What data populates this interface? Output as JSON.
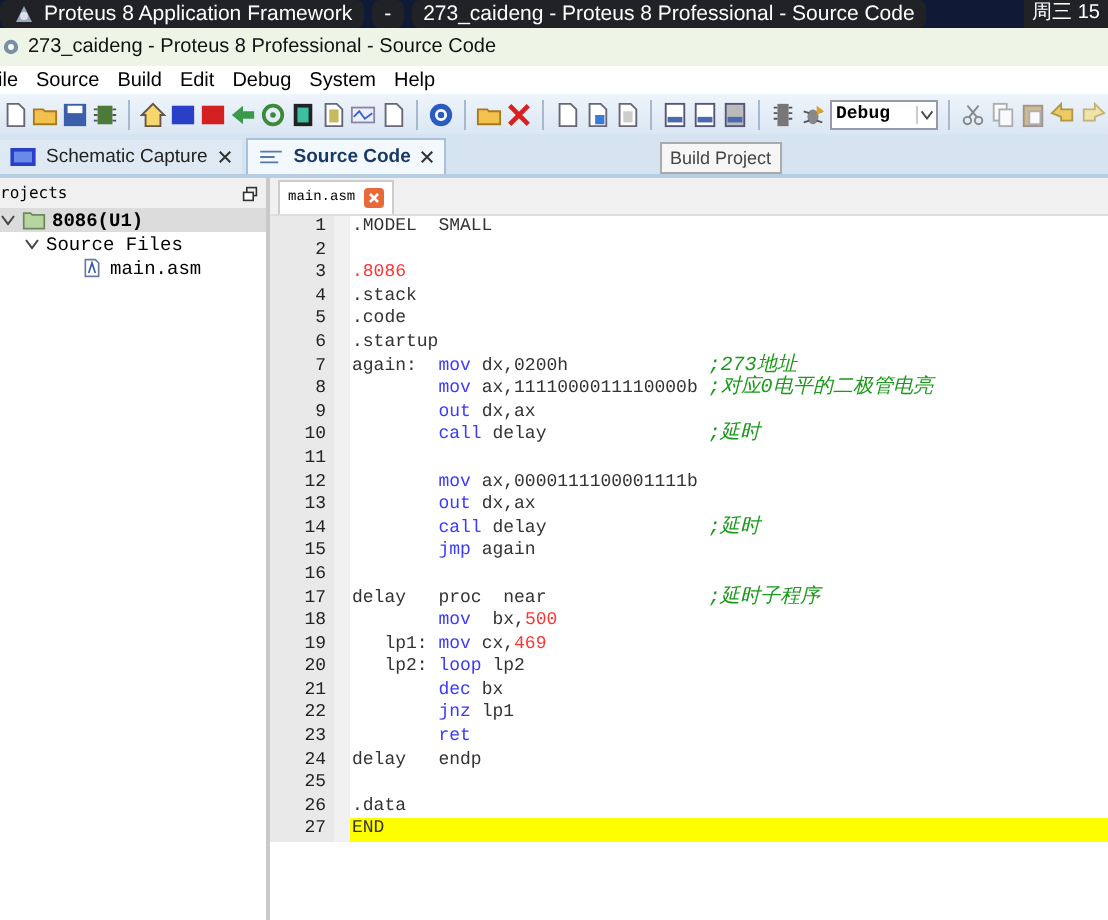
{
  "taskbar": {
    "items": [
      {
        "label": "Proteus 8 Application Framework"
      },
      {
        "label": "-"
      },
      {
        "label": "273_caideng - Proteus 8 Professional - Source Code"
      }
    ],
    "clock": "周三 15"
  },
  "window": {
    "title": "273_caideng - Proteus 8 Professional - Source Code"
  },
  "menu": [
    "ile",
    "Source",
    "Build",
    "Edit",
    "Debug",
    "System",
    "Help"
  ],
  "toolbar": {
    "configuration": "Debug"
  },
  "tooltip": "Build Project",
  "tabs": [
    {
      "label": "Schematic Capture",
      "selected": false
    },
    {
      "label": "Source Code",
      "selected": true
    }
  ],
  "projects": {
    "title": "rojects",
    "tree": [
      {
        "label": "8086(U1)",
        "expanded": true,
        "selected": true,
        "kind": "folder",
        "children": [
          {
            "label": "Source Files",
            "expanded": true,
            "children": [
              {
                "label": "main.asm",
                "kind": "file",
                "selected": false
              }
            ]
          }
        ]
      }
    ]
  },
  "editor": {
    "tab": "main.asm",
    "lines": [
      {
        "number": "1",
        "segments": [
          {
            "kind": "plain",
            "text": ".MODEL  SMALL"
          }
        ]
      },
      {
        "number": "2"
      },
      {
        "number": "3",
        "segments": [
          {
            "kind": "number",
            "text": ".8086"
          }
        ]
      },
      {
        "number": "4",
        "segments": [
          {
            "kind": "plain",
            "text": ".stack"
          }
        ]
      },
      {
        "number": "5",
        "segments": [
          {
            "kind": "plain",
            "text": ".code"
          }
        ]
      },
      {
        "number": "6",
        "segments": [
          {
            "kind": "plain",
            "text": ".startup"
          }
        ]
      },
      {
        "number": "7",
        "segments": [
          {
            "kind": "plain",
            "text": "again:  "
          },
          {
            "kind": "keyword",
            "text": "mov"
          },
          {
            "kind": "plain",
            "text": " dx,0200h             "
          },
          {
            "kind": "comment",
            "text": ";273地址"
          }
        ]
      },
      {
        "number": "8",
        "segments": [
          {
            "kind": "keyword",
            "text": "        mov"
          },
          {
            "kind": "plain",
            "text": " ax,1111000011110000b "
          },
          {
            "kind": "comment",
            "text": ";对应0电平的二极管电亮"
          }
        ]
      },
      {
        "number": "9",
        "segments": [
          {
            "kind": "keyword",
            "text": "        out"
          },
          {
            "kind": "plain",
            "text": " dx,ax"
          }
        ]
      },
      {
        "number": "10",
        "segments": [
          {
            "kind": "keyword",
            "text": "        call"
          },
          {
            "kind": "plain",
            "text": " delay               "
          },
          {
            "kind": "comment",
            "text": ";延时"
          }
        ]
      },
      {
        "number": "11"
      },
      {
        "number": "12",
        "segments": [
          {
            "kind": "keyword",
            "text": "        mov"
          },
          {
            "kind": "plain",
            "text": " ax,0000111100001111b"
          }
        ]
      },
      {
        "number": "13",
        "segments": [
          {
            "kind": "keyword",
            "text": "        out"
          },
          {
            "kind": "plain",
            "text": " dx,ax"
          }
        ]
      },
      {
        "number": "14",
        "segments": [
          {
            "kind": "keyword",
            "text": "        call"
          },
          {
            "kind": "plain",
            "text": " delay               "
          },
          {
            "kind": "comment",
            "text": ";延时"
          }
        ]
      },
      {
        "number": "15",
        "segments": [
          {
            "kind": "keyword",
            "text": "        jmp"
          },
          {
            "kind": "plain",
            "text": " again"
          }
        ]
      },
      {
        "number": "16"
      },
      {
        "number": "17",
        "segments": [
          {
            "kind": "plain",
            "text": "delay   proc  near               "
          },
          {
            "kind": "comment",
            "text": ";延时子程序"
          }
        ]
      },
      {
        "number": "18",
        "segments": [
          {
            "kind": "keyword",
            "text": "        mov"
          },
          {
            "kind": "plain",
            "text": "  bx,"
          },
          {
            "kind": "number",
            "text": "500"
          }
        ]
      },
      {
        "number": "19",
        "segments": [
          {
            "kind": "plain",
            "text": "   lp1: "
          },
          {
            "kind": "keyword",
            "text": "mov"
          },
          {
            "kind": "plain",
            "text": " cx,"
          },
          {
            "kind": "number",
            "text": "469"
          }
        ]
      },
      {
        "number": "20",
        "segments": [
          {
            "kind": "plain",
            "text": "   lp2: "
          },
          {
            "kind": "keyword",
            "text": "loop"
          },
          {
            "kind": "plain",
            "text": " lp2"
          }
        ]
      },
      {
        "number": "21",
        "segments": [
          {
            "kind": "keyword",
            "text": "        dec"
          },
          {
            "kind": "plain",
            "text": " bx"
          }
        ]
      },
      {
        "number": "22",
        "segments": [
          {
            "kind": "keyword",
            "text": "        jnz"
          },
          {
            "kind": "plain",
            "text": " lp1"
          }
        ]
      },
      {
        "number": "23",
        "segments": [
          {
            "kind": "keyword",
            "text": "        ret"
          }
        ]
      },
      {
        "number": "24",
        "segments": [
          {
            "kind": "plain",
            "text": "delay   endp"
          }
        ]
      },
      {
        "number": "25"
      },
      {
        "number": "26",
        "segments": [
          {
            "kind": "plain",
            "text": ".data"
          }
        ]
      },
      {
        "number": "27",
        "segments": [
          {
            "kind": "plain",
            "text": "END"
          }
        ],
        "highlighted": true
      }
    ]
  }
}
